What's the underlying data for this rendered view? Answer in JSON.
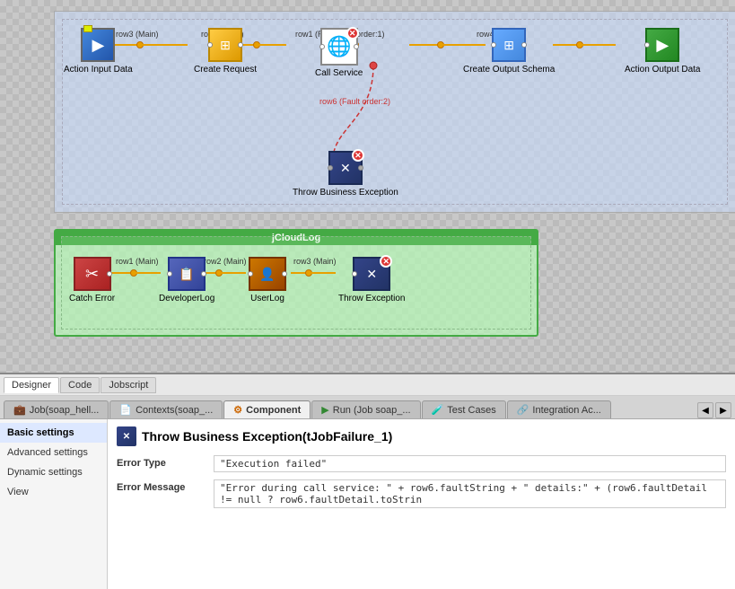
{
  "canvas": {
    "flow1": {
      "nodes": [
        {
          "id": "action-input",
          "label": "Action Input Data",
          "icon": "▶",
          "iconClass": "icon-action-input"
        },
        {
          "id": "create-request",
          "label": "Create Request",
          "icon": "⊞",
          "iconClass": "icon-transform"
        },
        {
          "id": "call-service",
          "label": "Call Service",
          "icon": "🌐",
          "iconClass": "icon-call-service"
        },
        {
          "id": "create-output-schema",
          "label": "Create Output Schema",
          "icon": "⊞",
          "iconClass": "icon-output-schema"
        },
        {
          "id": "action-output",
          "label": "Action Output Data",
          "icon": "▶",
          "iconClass": "icon-action-output"
        }
      ],
      "connectors": [
        {
          "label": "row3 (Main)"
        },
        {
          "label": "row2 (Main)"
        },
        {
          "label": "row1 (Response order:1)"
        },
        {
          "label": "row4 (Main)"
        }
      ],
      "fault_connector": {
        "label": "row6 (Fault order:2)"
      },
      "throw_node": {
        "label": "Throw Business Exception",
        "icon": "✕",
        "iconClass": "icon-throw"
      }
    },
    "flow2": {
      "title": "jCloudLog",
      "nodes": [
        {
          "id": "catch-error",
          "label": "Catch Error",
          "icon": "✂",
          "iconClass": "icon-catch"
        },
        {
          "id": "developer-log",
          "label": "DeveloperLog",
          "icon": "📋",
          "iconClass": "icon-dev-log"
        },
        {
          "id": "user-log",
          "label": "UserLog",
          "icon": "👤",
          "iconClass": "icon-user-log"
        },
        {
          "id": "throw-exception",
          "label": "Throw Exception",
          "icon": "✕",
          "iconClass": "icon-throw-ex",
          "hasError": true
        }
      ],
      "connectors": [
        {
          "label": "row1 (Main)"
        },
        {
          "label": "row2 (Main)"
        },
        {
          "label": "row3 (Main)"
        }
      ]
    }
  },
  "bottom_panel": {
    "view_tabs": [
      {
        "label": "Designer",
        "active": true
      },
      {
        "label": "Code",
        "active": false
      },
      {
        "label": "Jobscript",
        "active": false
      }
    ],
    "tabs": [
      {
        "label": "Job(soap_hell...",
        "icon": "briefcase",
        "active": false
      },
      {
        "label": "Contexts(soap_...",
        "icon": "doc",
        "active": false
      },
      {
        "label": "Component",
        "icon": "component",
        "active": true
      },
      {
        "label": "Run (Job soap_...",
        "icon": "run",
        "active": false
      },
      {
        "label": "Test Cases",
        "icon": "test",
        "active": false
      },
      {
        "label": "Integration Ac...",
        "icon": "integration",
        "active": false
      }
    ],
    "component": {
      "title": "Throw Business Exception(tJobFailure_1)",
      "sidebar_items": [
        {
          "label": "Basic settings",
          "active": true
        },
        {
          "label": "Advanced settings",
          "active": false
        },
        {
          "label": "Dynamic settings",
          "active": false
        },
        {
          "label": "View",
          "active": false
        }
      ],
      "fields": [
        {
          "label": "Error Type",
          "value": "\"Execution failed\""
        },
        {
          "label": "Error Message",
          "value": "\"Error during call service: \" + row6.faultString + \" details:\" + (row6.faultDetail != null ? row6.faultDetail.toStrin"
        }
      ]
    }
  }
}
